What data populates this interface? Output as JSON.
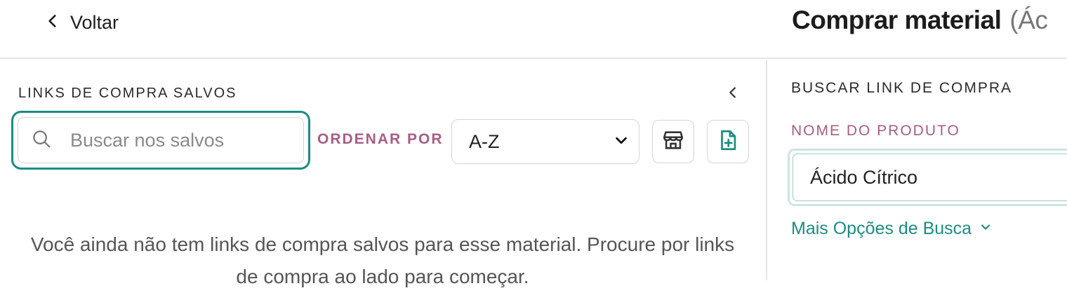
{
  "header": {
    "back_label": "Voltar",
    "title": "Comprar material",
    "title_suffix": "(Ác"
  },
  "saved_links": {
    "section_title": "LINKS DE COMPRA SALVOS",
    "search_placeholder": "Buscar nos salvos",
    "order_label": "ORDENAR POR",
    "order_value": "A-Z",
    "empty_message": "Você ainda não tem links de compra salvos para esse material. Procure por links de compra ao lado para começar."
  },
  "search_links": {
    "section_title": "BUSCAR LINK DE COMPRA",
    "product_label": "NOME DO PRODUTO",
    "product_value": "Ácido Cítrico",
    "more_options": "Mais Opções de Busca"
  },
  "icons": {
    "back": "chevron-left-icon",
    "collapse": "chevron-left-icon",
    "search": "search-icon",
    "dropdown": "chevron-down-icon",
    "store": "store-icon",
    "add_file": "file-plus-icon",
    "more_options": "chevron-down-icon"
  },
  "colors": {
    "accent_teal": "#1b8c82",
    "label_pink": "#a85d86"
  }
}
